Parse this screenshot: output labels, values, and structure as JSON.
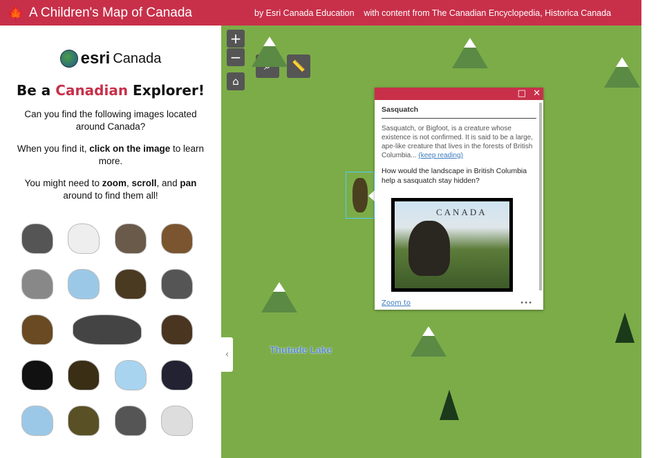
{
  "header": {
    "title": "A Children's Map of Canada",
    "credits": "by Esri Canada Education    with content from The Canadian Encyclopedia, Historica Canada",
    "icon": "maple-leaf-icon"
  },
  "sidebar": {
    "logo_brand": "esri",
    "logo_name": "Canada",
    "heading_pre": "Be a ",
    "heading_accent": "Canadian",
    "heading_post": " Explorer!",
    "p1": "Can you find the following images located around Canada?",
    "p2_pre": "When you find it, ",
    "p2_bold": "click on the image",
    "p2_post": " to learn more.",
    "p3_a": "You might need to ",
    "p3_b": "zoom",
    ", ": "",
    "p3_c": ", ",
    "p3_d": "scroll",
    "p3_e": ", and ",
    "p3_f": "pan",
    "p3_g": " around to find them all!",
    "images": [
      "walrus",
      "polar-bear",
      "caribou",
      "grizzly-bear",
      "inukshuk",
      "rain-cloud",
      "beaver",
      "wolf",
      "bison",
      "steam-train",
      "moose",
      "orca",
      "muskox",
      "iceberg",
      "narwhal",
      "cloud",
      "sasquatch",
      "seal",
      "horse"
    ]
  },
  "map": {
    "zoom_in": "+",
    "zoom_out": "−",
    "lake_label": "Thutade Lake",
    "collapse": "‹"
  },
  "popup": {
    "title": "Sasquatch",
    "text": "Sasquatch, or Bigfoot, is a creature whose existence is not confirmed. It is said to be a large, ape-like creature that lives in the forests of British Columbia...",
    "link": "(keep reading)",
    "question": "How would the landscape in British Columbia help a sasquatch stay hidden?",
    "stamp_text": "CANADA",
    "zoom_to": "Zoom to",
    "more": "•••",
    "maximize": "□",
    "close": "✕"
  }
}
